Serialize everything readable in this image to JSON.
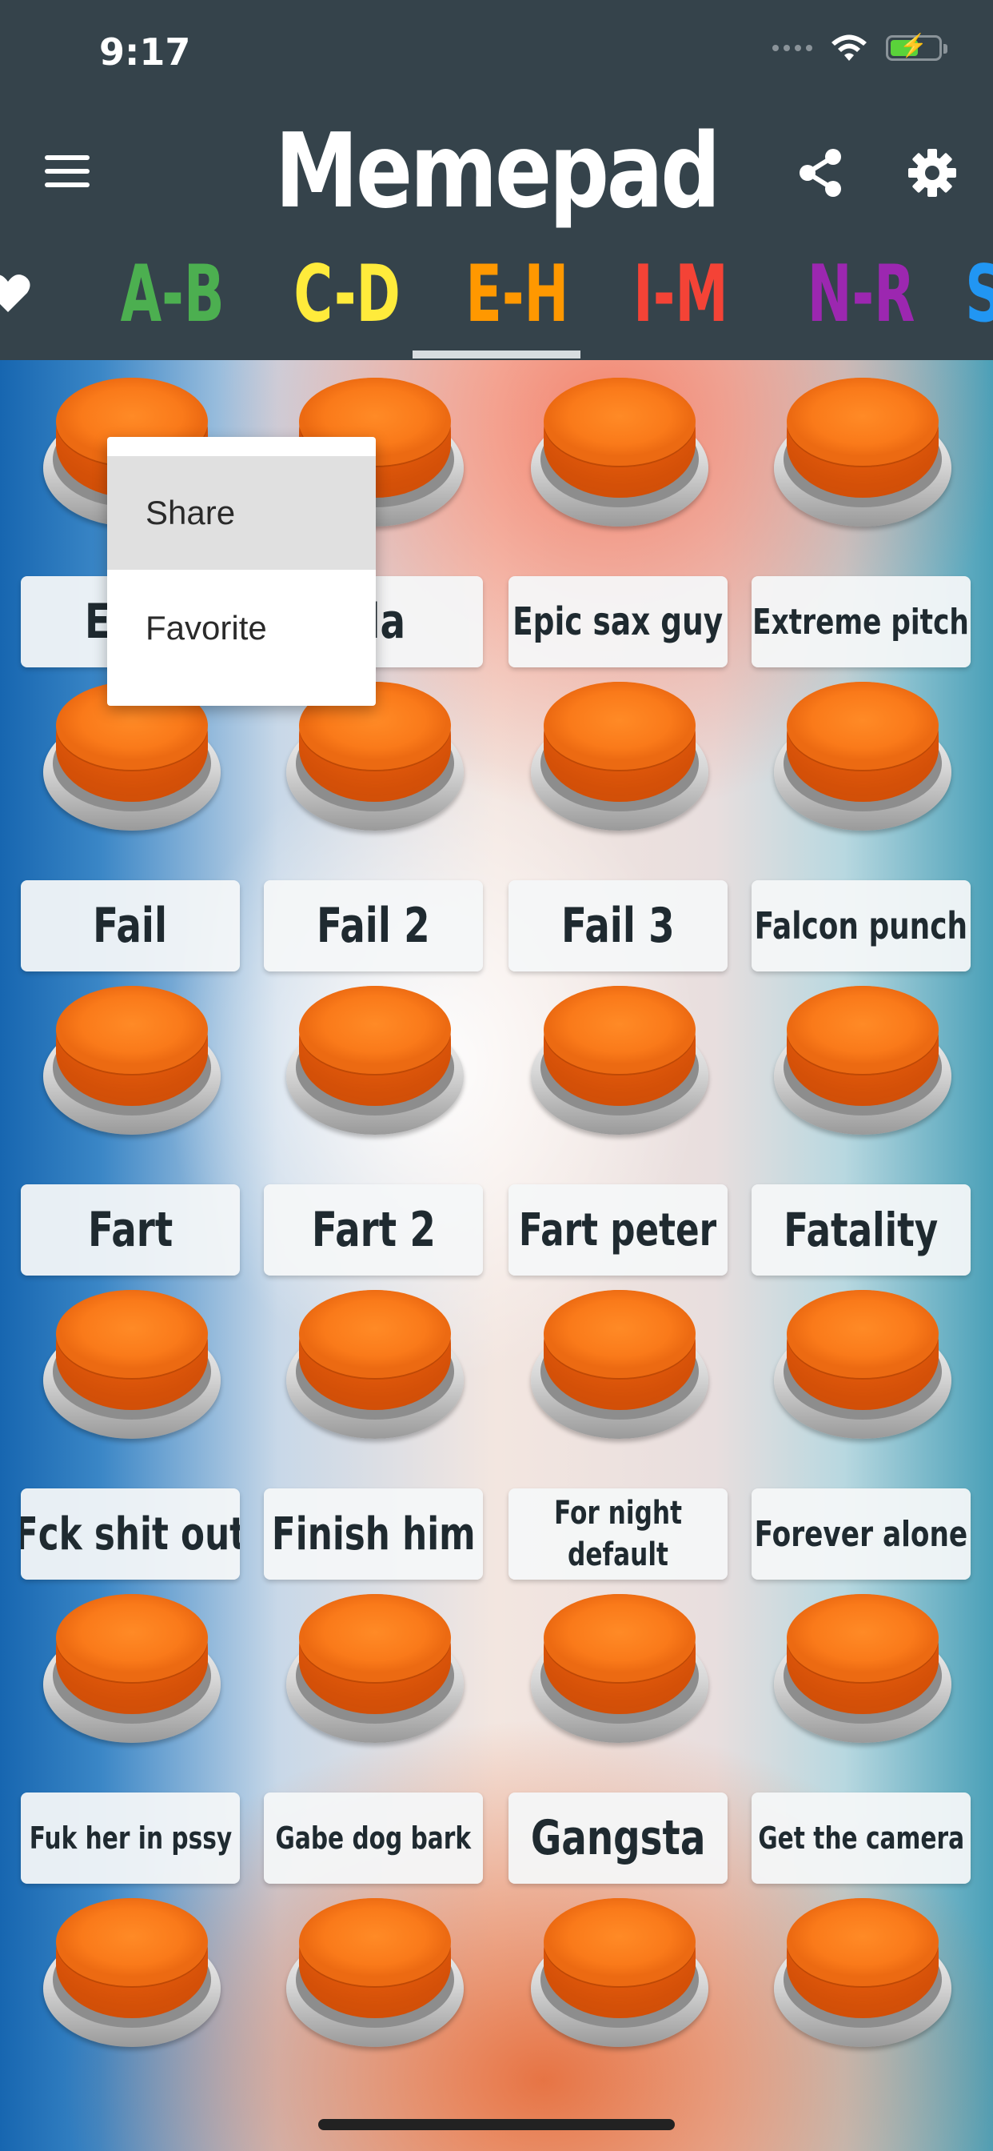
{
  "status_bar": {
    "time": "9:17"
  },
  "header": {
    "title": "Memepad"
  },
  "tabs": [
    {
      "label": "A-B",
      "color": "#4caf50"
    },
    {
      "label": "C-D",
      "color": "#ffeb3b"
    },
    {
      "label": "E-H",
      "color": "#ff9800",
      "selected": true
    },
    {
      "label": "I-M",
      "color": "#f44336"
    },
    {
      "label": "N-R",
      "color": "#9c27b0"
    },
    {
      "label": "S",
      "color": "#2196f3"
    }
  ],
  "sounds": [
    "Ea g",
    "ola",
    "Epic sax guy",
    "Extreme pitch",
    "Fail",
    "Fail 2",
    "Fail 3",
    "Falcon punch",
    "Fart",
    "Fart 2",
    "Fart peter",
    "Fatality",
    "Fck shit out",
    "Finish him",
    "For night default",
    "Forever alone",
    "Fuk her in pssy",
    "Gabe dog bark",
    "Gangsta",
    "Get the camera"
  ],
  "context_menu": {
    "items": [
      "Share",
      "Favorite"
    ]
  },
  "colors": {
    "header_bg": "#35434b",
    "button_orange": "#f97316",
    "label_bg": "#f4f6f8"
  }
}
